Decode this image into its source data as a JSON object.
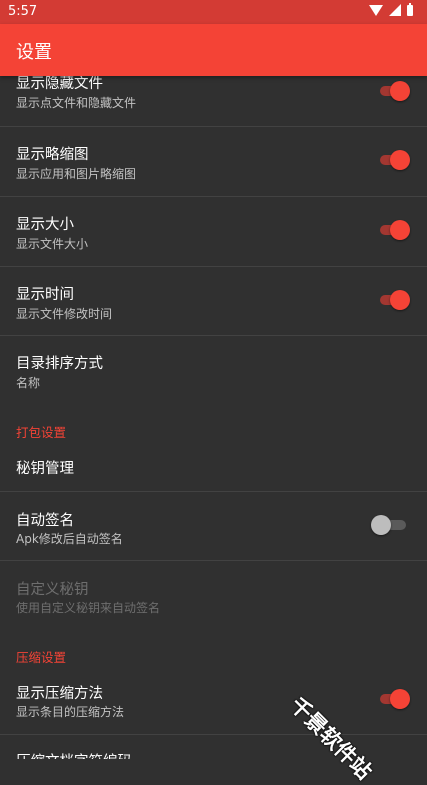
{
  "status_bar": {
    "time": "5:57"
  },
  "app_bar": {
    "title": "设置"
  },
  "prefs": {
    "hidden": {
      "title": "显示隐藏文件",
      "summary": "显示点文件和隐藏文件",
      "checked": true
    },
    "thumbnail": {
      "title": "显示略缩图",
      "summary": "显示应用和图片略缩图",
      "checked": true
    },
    "size": {
      "title": "显示大小",
      "summary": "显示文件大小",
      "checked": true
    },
    "time": {
      "title": "显示时间",
      "summary": "显示文件修改时间",
      "checked": true
    },
    "sort": {
      "title": "目录排序方式",
      "summary": "名称"
    }
  },
  "sections": {
    "pack": "打包设置",
    "compress": "压缩设置"
  },
  "pack": {
    "key_manage": {
      "title": "秘钥管理"
    },
    "auto_sign": {
      "title": "自动签名",
      "summary": "Apk修改后自动签名",
      "checked": false
    },
    "custom_key": {
      "title": "自定义秘钥",
      "summary": "使用自定义秘钥来自动签名",
      "enabled": false
    }
  },
  "compress": {
    "show_method": {
      "title": "显示压缩方法",
      "summary": "显示条目的压缩方法",
      "checked": true
    },
    "archive_encoding": {
      "title": "压缩文档字符编码"
    }
  },
  "watermark": "千景软件站",
  "colors": {
    "accent": "#f44336",
    "status_bar": "#d33b34",
    "background": "#303030"
  }
}
